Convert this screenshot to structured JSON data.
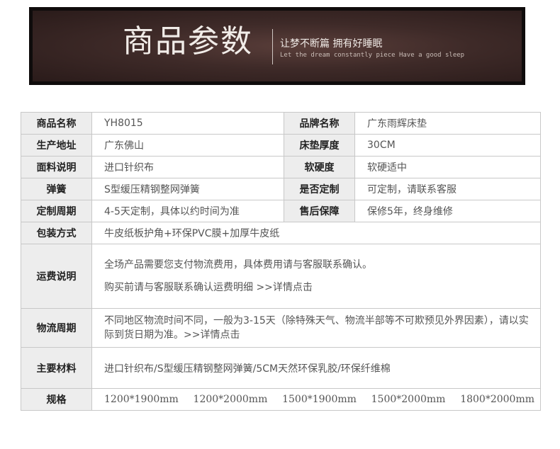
{
  "banner": {
    "title": "商品参数",
    "slogan": "让梦不断篇 拥有好睡眠",
    "subtitle": "Let the dream constantly piece Have a good sleep"
  },
  "rows": {
    "name_label": "商品名称",
    "name_value": "YH8015",
    "brand_label": "品牌名称",
    "brand_value": "广东雨辉床垫",
    "origin_label": "生产地址",
    "origin_value": "广东佛山",
    "thickness_label": "床垫厚度",
    "thickness_value": "30CM",
    "fabric_label": "面料说明",
    "fabric_value": "进口针织布",
    "hardness_label": "软硬度",
    "hardness_value": "软硬适中",
    "spring_label": "弹簧",
    "spring_value": "S型缓压精钢整网弹簧",
    "custom_label": "是否定制",
    "custom_value": "可定制，请联系客服",
    "cycle_label": "定制周期",
    "cycle_value": "4-5天定制，具体以约时间为准",
    "aftersale_label": "售后保障",
    "aftersale_value": "保修5年，终身维修",
    "package_label": "包装方式",
    "package_value": "牛皮纸板护角+环保PVC膜+加厚牛皮纸",
    "shipping_label": "运费说明",
    "shipping_line1": "全场产品需要您支付物流费用，具体费用请与客服联系确认。",
    "shipping_line2": "购买前请与客服联系确认运费明细  >>详情点击",
    "logistics_label": "物流周期",
    "logistics_value": "不同地区物流时间不同，一般为3-15天（除特殊天气、物流半部等不可欺预见外界因素），请以实际到货日期为准。>>详情点击",
    "material_label": "主要材料",
    "material_value": "进口针织布/S型缓压精钢整网弹簧/5CM天然环保乳胶/环保纤维棉",
    "spec_label": "规格",
    "specs": [
      "1200*1900mm",
      "1200*2000mm",
      "1500*1900mm",
      "1500*2000mm",
      "1800*2000mm"
    ]
  }
}
